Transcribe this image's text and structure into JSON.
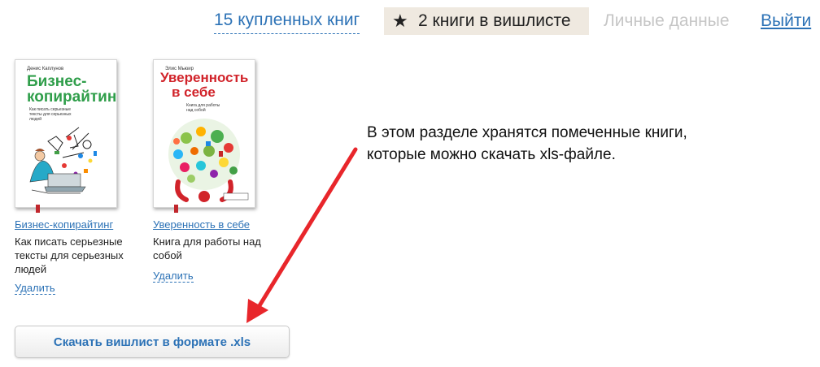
{
  "nav": {
    "purchased": "15 купленных книг",
    "wishlist_icon": "star-icon",
    "wishlist": "2 книги в вишлисте",
    "personal": "Личные данные",
    "logout": "Выйти"
  },
  "books": [
    {
      "cover_author": "Денис Каплунов",
      "cover_title_line1": "Бизнес-",
      "cover_title_line2": "копирайтинг",
      "cover_subtitle": "Как писать серьезные тексты для серьезных людей",
      "title": "Бизнес-копирайтинг",
      "desc": "Как писать серьезные тексты для серьезных людей",
      "remove": "Удалить"
    },
    {
      "cover_author": "Элис Мьюир",
      "cover_title_line1": "Уверенность",
      "cover_title_line2": "в себе",
      "cover_subtitle": "Книга для работы над собой",
      "title": "Уверенность в себе",
      "desc": "Книга для работы над собой",
      "remove": "Удалить"
    }
  ],
  "annotation": {
    "line1": "В этом разделе хранятся помеченные книги,",
    "line2": "которые можно скачать xls-файле."
  },
  "download_button": "Скачать вишлист в формате .xls",
  "colors": {
    "link": "#2c72b6",
    "wishlist_bg": "#efe9e0",
    "arrow": "#e8262b",
    "title_green": "#2f9e4a",
    "title_red": "#d1232a"
  }
}
